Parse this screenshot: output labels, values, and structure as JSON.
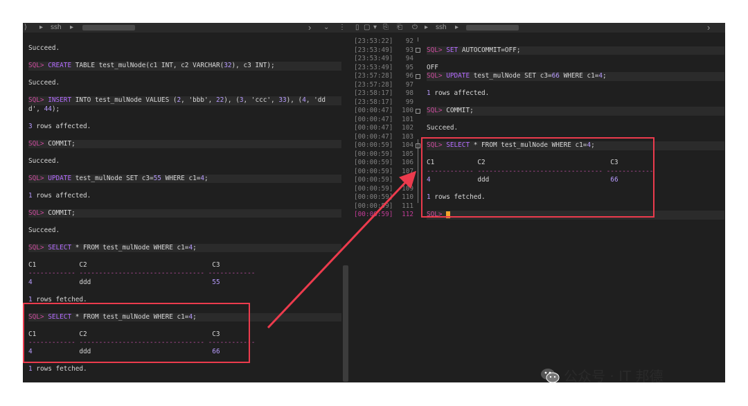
{
  "left": {
    "tab_label": "ssh",
    "lines": [
      {
        "t": "Succeed."
      },
      {
        "sql": true,
        "parts": [
          {
            "c": "pr",
            "v": "SQL> "
          },
          {
            "c": "kw",
            "v": "CREATE"
          },
          {
            "v": " TABLE test_mulNode(c1 INT, c2 VARCHAR("
          },
          {
            "c": "num",
            "v": "32"
          },
          {
            "v": "), c3 INT);"
          }
        ]
      },
      {
        "t": "Succeed."
      },
      {
        "sql": true,
        "parts": [
          {
            "c": "pr",
            "v": "SQL> "
          },
          {
            "c": "kw",
            "v": "INSERT"
          },
          {
            "v": " INTO test_mulNode VALUES ("
          },
          {
            "c": "num",
            "v": "2"
          },
          {
            "v": ", 'bbb', "
          },
          {
            "c": "num",
            "v": "22"
          },
          {
            "v": "), ("
          },
          {
            "c": "num",
            "v": "3"
          },
          {
            "v": ", 'ccc', "
          },
          {
            "c": "num",
            "v": "33"
          },
          {
            "v": "), ("
          },
          {
            "c": "num",
            "v": "4"
          },
          {
            "v": ", 'dd"
          }
        ]
      },
      {
        "parts": [
          {
            "v": "d', "
          },
          {
            "c": "num",
            "v": "44"
          },
          {
            "v": ");"
          }
        ]
      },
      {
        "parts": [
          {
            "c": "num",
            "v": "3"
          },
          {
            "v": " rows affected."
          }
        ]
      },
      {
        "sql": true,
        "parts": [
          {
            "c": "pr",
            "v": "SQL> "
          },
          {
            "v": "COMMIT;"
          }
        ]
      },
      {
        "t": "Succeed."
      },
      {
        "sql": true,
        "parts": [
          {
            "c": "pr",
            "v": "SQL> "
          },
          {
            "c": "kw",
            "v": "UPDATE"
          },
          {
            "v": " test_mulNode SET c3="
          },
          {
            "c": "num",
            "v": "55"
          },
          {
            "v": " WHERE c1="
          },
          {
            "c": "num",
            "v": "4"
          },
          {
            "v": ";"
          }
        ]
      },
      {
        "parts": [
          {
            "c": "num",
            "v": "1"
          },
          {
            "v": " rows affected."
          }
        ]
      },
      {
        "sql": true,
        "parts": [
          {
            "c": "pr",
            "v": "SQL> "
          },
          {
            "v": "COMMIT;"
          }
        ]
      },
      {
        "t": "Succeed."
      },
      {
        "sql": true,
        "parts": [
          {
            "c": "pr",
            "v": "SQL> "
          },
          {
            "c": "kw",
            "v": "SELECT"
          },
          {
            "v": " * FROM test_mulNode WHERE c1="
          },
          {
            "c": "num",
            "v": "4"
          },
          {
            "v": ";"
          }
        ]
      },
      {
        "t": "C1           C2                                C3"
      },
      {
        "parts": [
          {
            "c": "dash",
            "v": "------------ -------------------------------- ------------"
          }
        ]
      },
      {
        "parts": [
          {
            "c": "num",
            "v": "4"
          },
          {
            "v": "            ddd                               "
          },
          {
            "c": "num",
            "v": "55"
          }
        ]
      },
      {
        "parts": [
          {
            "c": "num",
            "v": "1"
          },
          {
            "v": " rows fetched."
          }
        ]
      },
      {
        "sql": true,
        "parts": [
          {
            "c": "pr",
            "v": "SQL> "
          },
          {
            "c": "kw",
            "v": "SELECT"
          },
          {
            "v": " * FROM test_mulNode WHERE c1="
          },
          {
            "c": "num",
            "v": "4"
          },
          {
            "v": ";"
          }
        ]
      },
      {
        "t": "C1           C2                                C3"
      },
      {
        "parts": [
          {
            "c": "dash",
            "v": "------------ -------------------------------- ------------"
          }
        ]
      },
      {
        "parts": [
          {
            "c": "num",
            "v": "4"
          },
          {
            "v": "            ddd                               "
          },
          {
            "c": "num",
            "v": "66"
          }
        ]
      },
      {
        "parts": [
          {
            "c": "num",
            "v": "1"
          },
          {
            "v": " rows fetched."
          }
        ]
      }
    ]
  },
  "right": {
    "tab_label": "ssh",
    "gutter": [
      {
        "ts": "[23:53:22]",
        "ln": "92"
      },
      {
        "ts": "[23:53:49]",
        "ln": "93"
      },
      {
        "ts": "[23:53:49]",
        "ln": "94"
      },
      {
        "ts": "[23:53:49]",
        "ln": "95"
      },
      {
        "ts": "[23:57:28]",
        "ln": "96"
      },
      {
        "ts": "[23:57:28]",
        "ln": "97"
      },
      {
        "ts": "[23:58:17]",
        "ln": "98"
      },
      {
        "ts": "[23:58:17]",
        "ln": "99"
      },
      {
        "ts": "[00:00:47]",
        "ln": "100"
      },
      {
        "ts": "[00:00:47]",
        "ln": "101"
      },
      {
        "ts": "[00:00:47]",
        "ln": "102"
      },
      {
        "ts": "[00:00:47]",
        "ln": "103"
      },
      {
        "ts": "[00:00:59]",
        "ln": "104"
      },
      {
        "ts": "[00:00:59]",
        "ln": "105"
      },
      {
        "ts": "[00:00:59]",
        "ln": "106"
      },
      {
        "ts": "[00:00:59]",
        "ln": "107"
      },
      {
        "ts": "[00:00:59]",
        "ln": "108"
      },
      {
        "ts": "[00:00:59]",
        "ln": "109"
      },
      {
        "ts": "[00:00:59]",
        "ln": "110"
      },
      {
        "ts": "[00:00:59]",
        "ln": "111"
      },
      {
        "ts": "[00:00:59]",
        "ln": "112"
      }
    ],
    "lines": [
      {
        "row": 1,
        "sql": true,
        "parts": [
          {
            "c": "pr",
            "v": "SQL> "
          },
          {
            "c": "kw",
            "v": "SET"
          },
          {
            "v": " AUTOCOMMIT=OFF;"
          }
        ]
      },
      {
        "row": 3,
        "parts": [
          {
            "v": "OFF"
          }
        ]
      },
      {
        "row": 4,
        "sql": true,
        "parts": [
          {
            "c": "pr",
            "v": "SQL> "
          },
          {
            "c": "kw",
            "v": "UPDATE"
          },
          {
            "v": " test_mulNode SET c3="
          },
          {
            "c": "num",
            "v": "66"
          },
          {
            "v": " WHERE c1="
          },
          {
            "c": "num",
            "v": "4"
          },
          {
            "v": ";"
          }
        ]
      },
      {
        "row": 6,
        "parts": [
          {
            "c": "num",
            "v": "1"
          },
          {
            "v": " rows affected."
          }
        ]
      },
      {
        "row": 8,
        "sql": true,
        "parts": [
          {
            "c": "pr",
            "v": "SQL> "
          },
          {
            "v": "COMMIT;"
          }
        ]
      },
      {
        "row": 10,
        "parts": [
          {
            "v": "Succeed."
          }
        ]
      },
      {
        "row": 12,
        "sql": true,
        "parts": [
          {
            "c": "pr",
            "v": "SQL> "
          },
          {
            "c": "kw",
            "v": "SELECT"
          },
          {
            "v": " * FROM test_mulNode WHERE c1="
          },
          {
            "c": "num",
            "v": "4"
          },
          {
            "v": ";"
          }
        ]
      },
      {
        "row": 14,
        "parts": [
          {
            "v": "C1           C2                                C3"
          }
        ]
      },
      {
        "row": 15,
        "parts": [
          {
            "c": "dash",
            "v": "------------ -------------------------------- ------------"
          }
        ]
      },
      {
        "row": 16,
        "parts": [
          {
            "c": "num",
            "v": "4"
          },
          {
            "v": "            ddd                               "
          },
          {
            "c": "num",
            "v": "66"
          }
        ]
      },
      {
        "row": 18,
        "parts": [
          {
            "c": "num",
            "v": "1"
          },
          {
            "v": " rows fetched."
          }
        ]
      },
      {
        "row": 20,
        "sql": true,
        "cursor": true,
        "parts": [
          {
            "c": "pr",
            "v": "SQL> "
          }
        ]
      }
    ]
  },
  "watermark": {
    "text": "公众号 · IT 邦德"
  },
  "colors": {
    "annotation": "#ec3b4d",
    "prompt": "#cc4b9d",
    "keyword": "#b46cff",
    "cursor": "#f2a52d"
  }
}
